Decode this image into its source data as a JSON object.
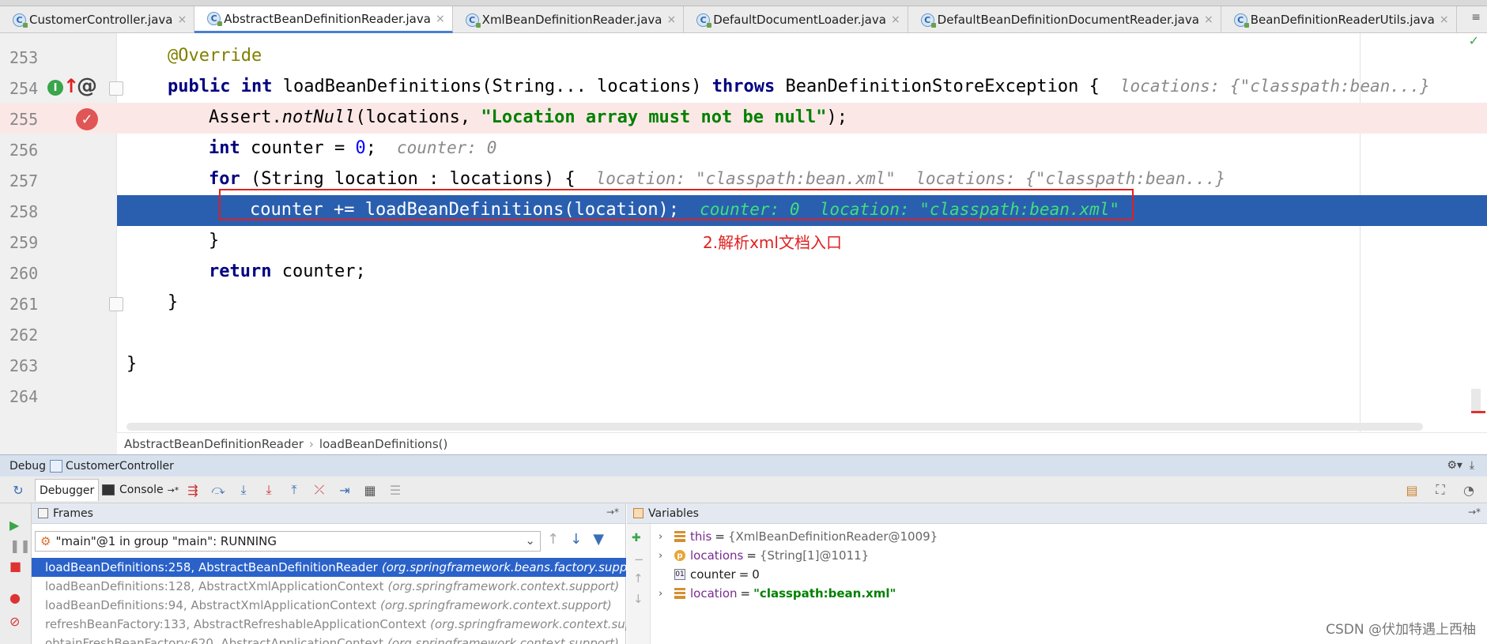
{
  "tabs": [
    {
      "label": "CustomerController.java",
      "active": false,
      "closable": true
    },
    {
      "label": "AbstractBeanDefinitionReader.java",
      "active": true,
      "closable": true
    },
    {
      "label": "XmlBeanDefinitionReader.java",
      "active": false,
      "closable": true
    },
    {
      "label": "DefaultDocumentLoader.java",
      "active": false,
      "closable": true
    },
    {
      "label": "DefaultBeanDefinitionDocumentReader.java",
      "active": false,
      "closable": true
    },
    {
      "label": "BeanDefinitionReaderUtils.java",
      "active": false,
      "closable": true
    }
  ],
  "tab_close_glyph": "×",
  "tab_menu_glyph": "≡",
  "editor": {
    "line_numbers": [
      "253",
      "254",
      "255",
      "256",
      "257",
      "258",
      "259",
      "260",
      "261",
      "262",
      "263",
      "264"
    ],
    "code": {
      "l253": "@Override",
      "l254_kw1": "public",
      "l254_kw2": "int",
      "l254_sig": "loadBeanDefinitions(String... locations)",
      "l254_kw3": "throws",
      "l254_rest": "BeanDefinitionStoreException {",
      "l254_hint": "locations: {\"classpath:bean...}",
      "l255_a": "Assert.",
      "l255_b": "notNull",
      "l255_c": "(locations, ",
      "l255_str": "\"Location array must not be null\"",
      "l255_d": ");",
      "l256_kw": "int",
      "l256_a": "counter = ",
      "l256_num": "0",
      "l256_b": ";",
      "l256_hint": "counter: 0",
      "l257_kw": "for",
      "l257_a": "(String location : locations) {",
      "l257_hint": "location: \"classpath:bean.xml\"  locations: {\"classpath:bean...}",
      "l258_code": "counter += loadBeanDefinitions(location);",
      "l258_hint": "counter: 0  location: \"classpath:bean.xml\"",
      "l259": "}",
      "l260_kw": "return",
      "l260_a": "counter;",
      "l261": "}",
      "l263": "}"
    },
    "annotation_note": "2.解析xml文档入口"
  },
  "breadcrumb": [
    "AbstractBeanDefinitionReader",
    "loadBeanDefinitions()"
  ],
  "debug": {
    "title_label": "Debug",
    "config_name": "CustomerController",
    "tabs": {
      "debugger": "Debugger",
      "console": "Console"
    },
    "frames_title": "Frames",
    "variables_title": "Variables",
    "thread": "\"main\"@1 in group \"main\": RUNNING",
    "frames": [
      {
        "method": "loadBeanDefinitions:258, AbstractBeanDefinitionReader",
        "pkg": "(org.springframework.beans.factory.support)",
        "selected": true
      },
      {
        "method": "loadBeanDefinitions:128, AbstractXmlApplicationContext",
        "pkg": "(org.springframework.context.support)",
        "selected": false
      },
      {
        "method": "loadBeanDefinitions:94, AbstractXmlApplicationContext",
        "pkg": "(org.springframework.context.support)",
        "selected": false
      },
      {
        "method": "refreshBeanFactory:133, AbstractRefreshableApplicationContext",
        "pkg": "(org.springframework.context.support)",
        "selected": false
      },
      {
        "method": "obtainFreshBeanFactory:620, AbstractApplicationContext",
        "pkg": "(org.springframework.context.support)",
        "selected": false
      }
    ],
    "variables": [
      {
        "name": "this",
        "value": "{XmlBeanDefinitionReader@1009}",
        "kind": "object",
        "expandable": true
      },
      {
        "name": "locations",
        "value": "{String[1]@1011}",
        "kind": "param",
        "expandable": true
      },
      {
        "name": "counter",
        "value": "0",
        "kind": "primitive",
        "expandable": false
      },
      {
        "name": "location",
        "value": "\"classpath:bean.xml\"",
        "kind": "object",
        "expandable": true
      }
    ]
  },
  "watermark": "CSDN @伏加特遇上西柚",
  "colors": {
    "execution_line": "#2a5fb0",
    "error_line": "#fbe8e6",
    "annotation_red": "#e02020",
    "selected_frame": "#2a62c9"
  }
}
